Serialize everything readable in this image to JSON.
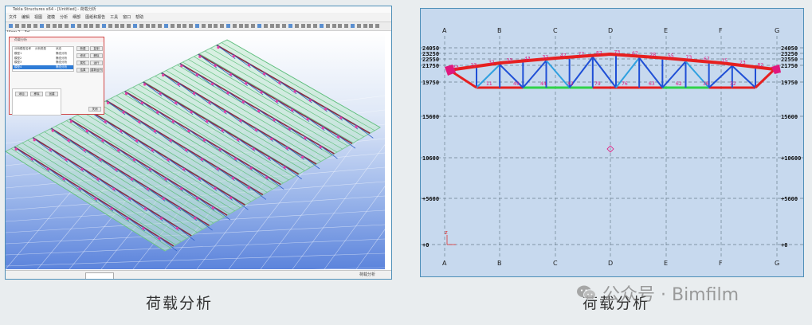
{
  "captions": {
    "left": "荷载分析",
    "right": "荷载分析"
  },
  "watermark": {
    "text": "公众号 · Bimfilm",
    "icon": "wechat-icon"
  },
  "left_app": {
    "title": "Tekla Structures x64 - [Untitled] - 荷载分析",
    "menus": [
      "文件",
      "编辑",
      "视图",
      "建模",
      "分析",
      "细部",
      "图纸和报告",
      "工具",
      "窗口",
      "帮助"
    ],
    "view_title": "View 1 - 3d",
    "dialog": {
      "title": "荷载分析",
      "list_headers": [
        "分析模型名称",
        "分析类型",
        "状态"
      ],
      "list_rows": [
        [
          "模型1",
          "",
          "静态分析"
        ],
        [
          "模型2",
          "",
          "静态分析"
        ],
        [
          "模型3",
          "",
          "静态分析"
        ],
        [
          "模型4",
          "",
          "静态分析"
        ]
      ],
      "side_buttons": [
        "新建",
        "复制",
        "修改",
        "删除",
        "属性",
        "运行",
        "结果",
        "重新运行"
      ],
      "lower_buttons": [
        "添加",
        "移除",
        "创建"
      ],
      "ok_label": "关闭"
    },
    "status_input": "",
    "status_text": "荷载分析"
  },
  "right_view": {
    "grid_labels": [
      "A",
      "B",
      "C",
      "D",
      "E",
      "F",
      "G"
    ],
    "left_levels": [
      "24050",
      "23250",
      "22550",
      "21750",
      "19750",
      "15600",
      "10600",
      "+5600",
      "+0"
    ],
    "right_levels": [
      "24050",
      "23250",
      "22550",
      "21750",
      "19750",
      "15600",
      "+10600",
      "+5600",
      "+0"
    ],
    "truss_labels_top": [
      "33",
      "23",
      "32",
      "33",
      "43",
      "32",
      "47",
      "77",
      "87",
      "73",
      "67",
      "28",
      "55",
      "73",
      "67",
      "15",
      "23",
      "82"
    ],
    "truss_labels_bottom": [
      "11",
      "49",
      "44",
      "42",
      "79",
      "76",
      "63",
      "62",
      "36",
      "32"
    ],
    "axis_marker": "z",
    "colors": {
      "chord": "#e62020",
      "diagonal": "#1f4fd6",
      "bottom_mid": "#2fd24a",
      "label": "#e0177d",
      "grid": "#6c7f8f",
      "background": "#c7d9ee"
    }
  }
}
